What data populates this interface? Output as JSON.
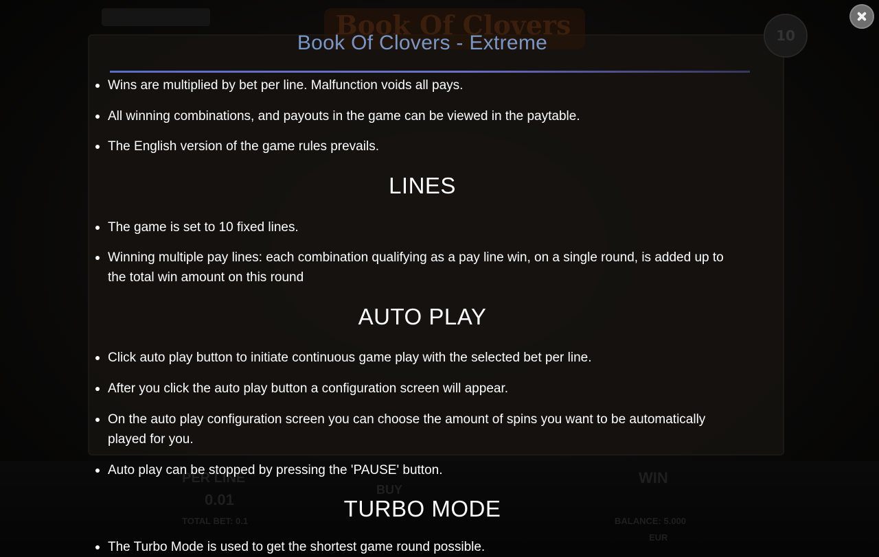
{
  "modal": {
    "title": "Book Of Clovers - Extreme",
    "close_label": "✕"
  },
  "sections": {
    "general": [
      "Wins are multiplied by bet per line. Malfunction voids all pays.",
      "All winning combinations, and payouts in the game can be viewed in the paytable.",
      "The English version of the game rules prevails."
    ],
    "lines_heading": "LINES",
    "lines": [
      "The game is set to 10 fixed lines.",
      "Winning multiple pay lines: each combination qualifying as a pay line win, on a single round, is added up to the total win amount on this round"
    ],
    "autoplay_heading": "AUTO PLAY",
    "autoplay": [
      "Click auto play button to initiate continuous game play with the selected bet per line.",
      "After you click the auto play button a configuration screen will appear.",
      "On the auto play configuration screen you can choose the amount of spins you want to be automatically played for you.",
      "Auto play can be stopped by pressing the 'PAUSE' button."
    ],
    "turbo_heading": "TURBO MODE",
    "turbo": [
      "The Turbo Mode is used to get the shortest game round possible."
    ]
  },
  "background": {
    "logo_text": "Book Of Clovers",
    "badge": "10",
    "bet_label": "PER LINE",
    "bet_value": "0.01",
    "total_bet": "TOTAL BET: 0.1",
    "win_label": "WIN",
    "balance": "BALANCE: 5.000",
    "currency": "EUR",
    "buy_label": "BUY"
  }
}
